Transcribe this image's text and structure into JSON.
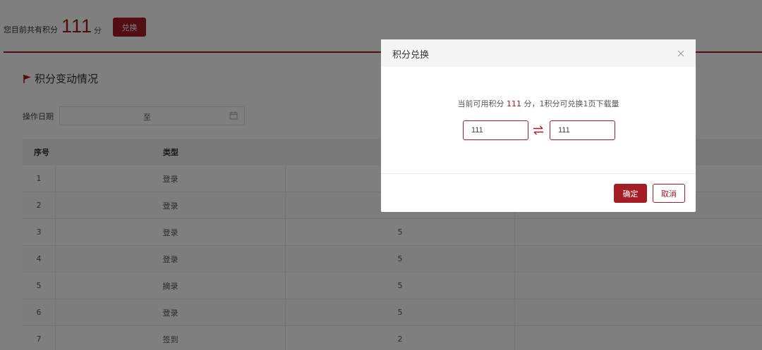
{
  "header": {
    "points_label": "您目前共有积分",
    "points_value": "111",
    "points_unit": "分",
    "redeem_button": "兑换"
  },
  "section": {
    "title": "积分变动情况",
    "icon": "flag-icon"
  },
  "filter": {
    "date_label": "操作日期",
    "range_separator": "至",
    "icon": "calendar-icon"
  },
  "table": {
    "columns": [
      "序号",
      "类型"
    ],
    "rows": [
      {
        "no": "1",
        "type": "登录",
        "points": ""
      },
      {
        "no": "2",
        "type": "登录",
        "points": ""
      },
      {
        "no": "3",
        "type": "登录",
        "points": "5"
      },
      {
        "no": "4",
        "type": "登录",
        "points": "5"
      },
      {
        "no": "5",
        "type": "摘录",
        "points": "5"
      },
      {
        "no": "6",
        "type": "登录",
        "points": "5"
      },
      {
        "no": "7",
        "type": "签到",
        "points": "2"
      }
    ]
  },
  "modal": {
    "title": "积分兑换",
    "info_prefix": "当前可用积分",
    "info_points": "111",
    "info_suffix": "分，1积分可兑换1页下载量",
    "input_points": "111",
    "input_pages": "111",
    "confirm_button": "确定",
    "cancel_button": "取消",
    "close_icon": "close-icon",
    "swap_icon": "swap-icon"
  },
  "colors": {
    "accent": "#a51c24",
    "overlay": "rgba(0,0,0,0.5)"
  }
}
